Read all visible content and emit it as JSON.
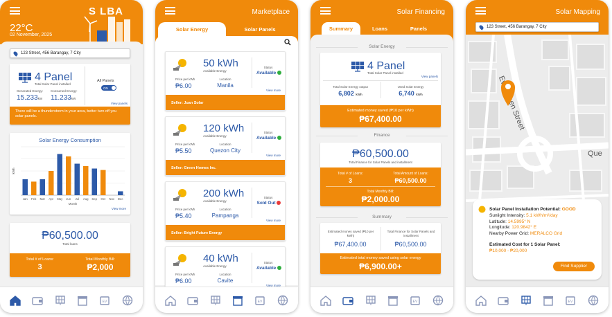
{
  "home": {
    "temp": "22°C",
    "date": "02 November, 2025",
    "logo": "S  LBA",
    "address": "123 Street, 456 Barangay, 7 City",
    "panel_count": "4 Panel",
    "panel_sub": "Total Solar Panel installed",
    "generated_label": "Generated Energy:",
    "generated_value": "15.233",
    "generated_unit": "kW",
    "consumed_label": "Consumed Energy:",
    "consumed_value": "11.233",
    "consumed_unit": "kW",
    "all_panels_label": "All Panels",
    "toggle_label": "ON",
    "view_panels": "View panels",
    "alert": "There will be a thunderstorm in your area, better turn off you solar panels.",
    "chart_title": "Solar Energy Consumption",
    "view_more": "View more",
    "loans_amount": "₱60,500.00",
    "loans_label": "Total loans",
    "num_loans_label": "Total # of Loans:",
    "num_loans": "3",
    "monthly_bill_label": "Total Monthly Bill:",
    "monthly_bill": "₱2,000"
  },
  "chart_data": {
    "type": "bar",
    "title": "Solar Energy Consumption",
    "xlabel": "Month",
    "ylabel": "kWh",
    "categories": [
      "Jan",
      "Feb",
      "Mar",
      "Apr",
      "May",
      "Jun",
      "Jul",
      "Aug",
      "Sep",
      "Oct",
      "Nov",
      "Dec"
    ],
    "values": [
      33,
      28,
      33,
      50,
      85,
      80,
      65,
      60,
      55,
      52,
      0,
      8
    ],
    "colors": [
      "#2d5aa8",
      "#f08a0b",
      "#2d5aa8",
      "#f08a0b",
      "#2d5aa8",
      "#f08a0b",
      "#2d5aa8",
      "#f08a0b",
      "#2d5aa8",
      "#f08a0b",
      "#2d5aa8",
      "#2d5aa8"
    ],
    "ylim": [
      0,
      100
    ],
    "grid": true
  },
  "market": {
    "title": "Marketplace",
    "tab_energy": "Solar Energy",
    "tab_panels": "Solar Panels",
    "price_label": "Price per kWh",
    "location_label": "Location",
    "status_label": "Status",
    "view_more": "View more",
    "listings": [
      {
        "kwh": "50 kWh",
        "sub": "Available Energy",
        "price": "₱6.00",
        "location": "Manila",
        "status": "Available",
        "seller": "Seller: Juan Solar"
      },
      {
        "kwh": "120 kWh",
        "sub": "Available Energy",
        "price": "₱5.50",
        "location": "Quezon City",
        "status": "Available",
        "seller": "Seller: Green Homes Inc."
      },
      {
        "kwh": "200 kWh",
        "sub": "Available Energy",
        "price": "₱5.40",
        "location": "Pampanga",
        "status": "Sold Out",
        "seller": "Seller: Bright Future Energy"
      },
      {
        "kwh": "40 kWh",
        "sub": "Available Energy",
        "price": "₱6.00",
        "location": "Cavite",
        "status": "Available",
        "seller": ""
      }
    ]
  },
  "finance": {
    "title": "Solar Financing",
    "tab_summary": "Summary",
    "tab_loans": "Loans",
    "tab_panels": "Panels",
    "sec_energy": "Solar Energy",
    "panel_count": "4 Panel",
    "panel_sub": "Total Solar Panel installed",
    "view_panels": "View panels",
    "output_label": "Total Solar Energy output",
    "output_value": "6,802",
    "used_label": "Used Solar Energy",
    "used_value": "6,740",
    "unit": "kWh",
    "saved_label": "Estimated money saved (₱10 per kWh)",
    "saved_value": "₱67,400.00",
    "sec_finance": "Finance",
    "loans_amount": "₱60,500.00",
    "loans_sub": "Total Finance for Solar Panels and installment",
    "num_loans_label": "Total # of Loans:",
    "num_loans": "3",
    "loan_amount_label": "Total Amount of Loans:",
    "loan_amount": "₱60,500.00",
    "monthly_label": "Total Monthly Bill:",
    "monthly_value": "₱2,000.00",
    "sec_summary": "Summary",
    "sum_saved_label": "Estimated money saved (₱10 per kWh)",
    "sum_saved": "₱67,400.00",
    "sum_finance_label": "Total Finance for Solar Panels and installment",
    "sum_finance": "₱60,500.00",
    "net_label": "Estimated total money saved using solar energy",
    "net_value": "₱6,900.00+"
  },
  "mapping": {
    "title": "Solar Mapping",
    "address": "123 Street, 456 Barangay, 7 City",
    "street1": "Evergreen Street",
    "street2": "Que",
    "potential_label": "Solar Panel Installation Potential:",
    "potential_value": "GOOD",
    "sunlight_label": "Sunlight Intensity:",
    "sunlight_value": "5.1 kWh/m²/day",
    "lat_label": "Latitude:",
    "lat_value": "14.5995° N",
    "lon_label": "Longitude:",
    "lon_value": "120.9842° E",
    "grid_label": "Nearby Power Grid:",
    "grid_value": "MERALCO Grid",
    "cost_label": "Estimated Cost for 1 Solar Panel:",
    "cost_value": "₱10,000 - ₱20,000",
    "find_button": "Find Supplier"
  },
  "nav_icons": [
    "home-icon",
    "wallet-icon",
    "solar-panel-icon",
    "store-icon",
    "ev-icon",
    "globe-icon"
  ],
  "colors": {
    "accent": "#f08a0b",
    "brand_blue": "#2d5aa8",
    "available": "#2fae3f",
    "sold_out": "#e83a3a"
  }
}
